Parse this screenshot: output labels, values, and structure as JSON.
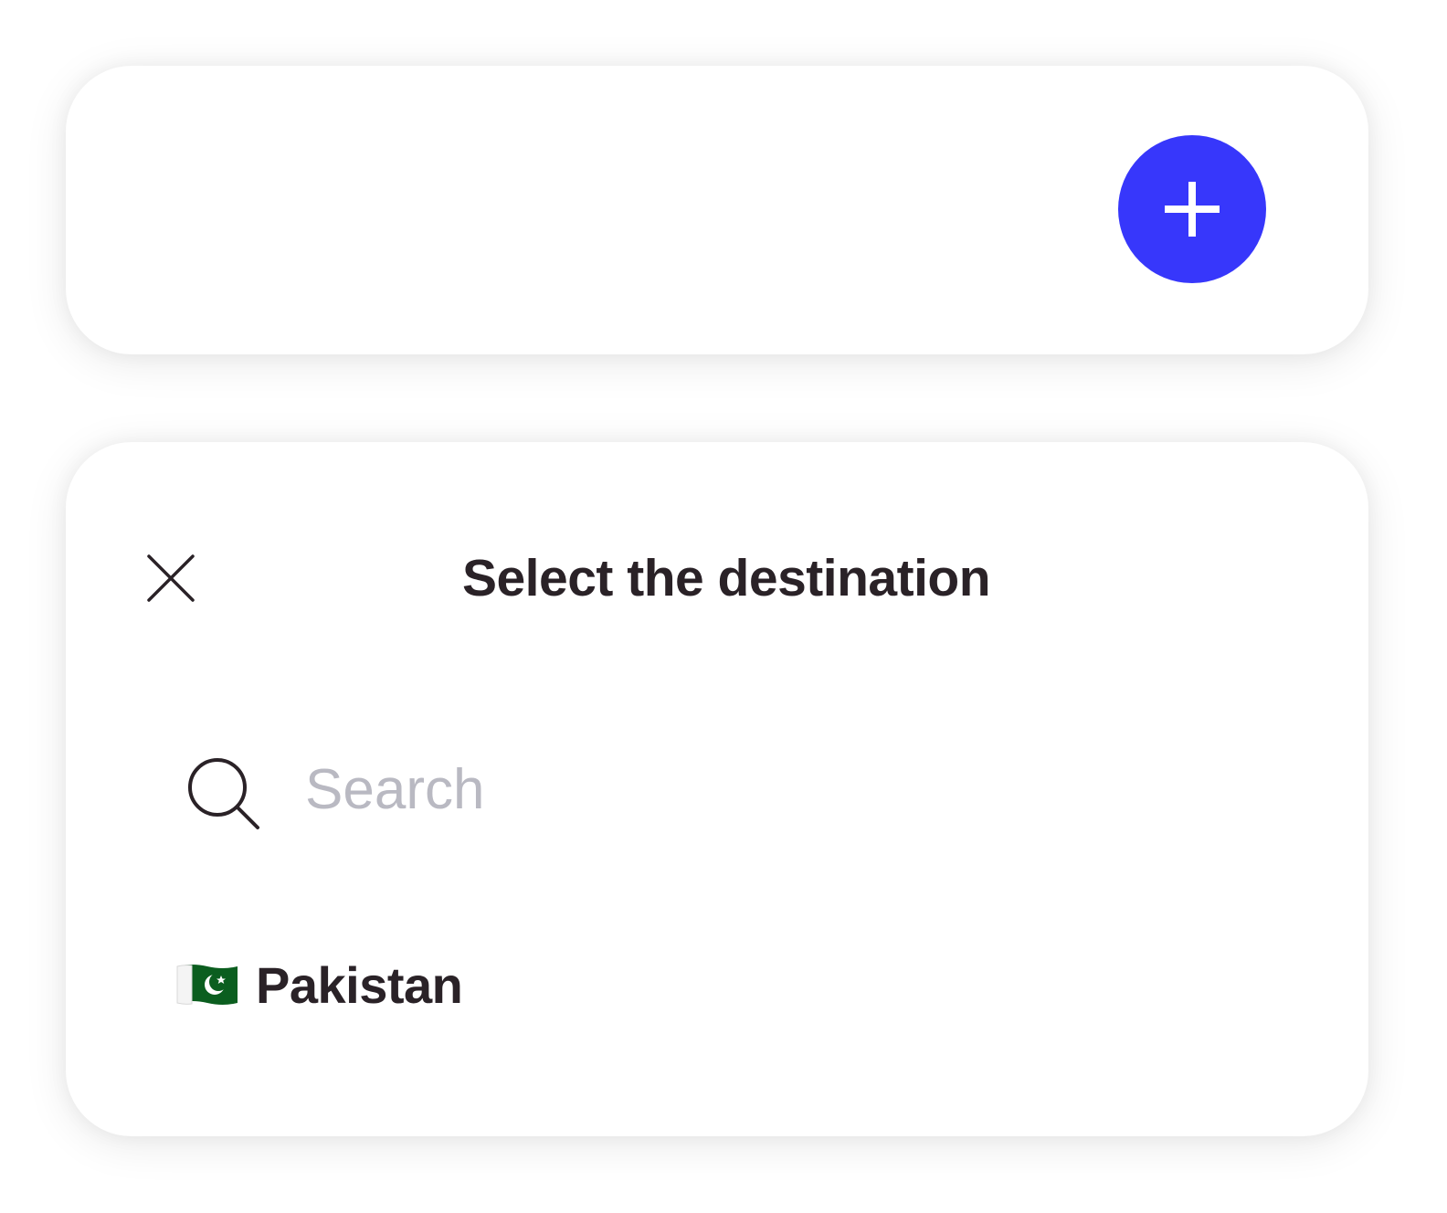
{
  "top_card": {
    "add_button_icon": "plus-icon",
    "accent_color": "#3737fb"
  },
  "destination_sheet": {
    "close_icon": "close-icon",
    "title": "Select the destination",
    "search": {
      "icon": "search-icon",
      "placeholder": "Search",
      "value": ""
    },
    "countries": [
      {
        "flag_icon": "pakistan-flag-icon",
        "name": "Pakistan"
      }
    ]
  }
}
